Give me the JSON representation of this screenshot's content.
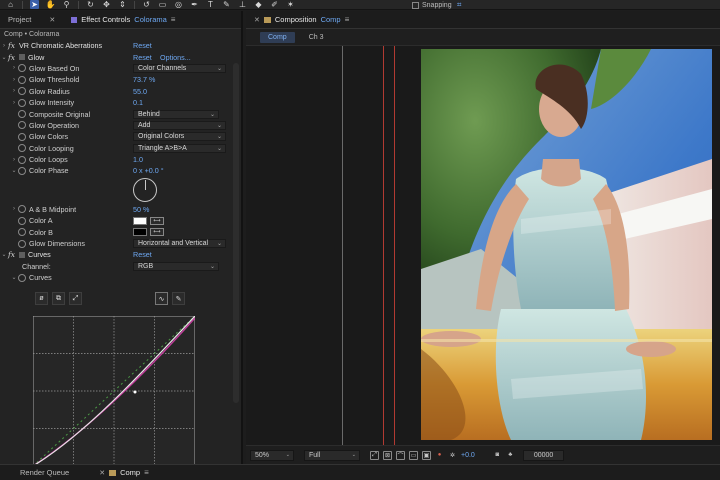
{
  "toolbar": {
    "icons": [
      "home-icon",
      "selection-tool-icon",
      "hand-tool-icon",
      "zoom-tool-icon",
      "orbit-tool-icon",
      "pan-tool-icon",
      "dolly-tool-icon",
      "rotate-tool-icon",
      "camera-tool-icon",
      "pan-behind-tool-icon",
      "pen-tool-icon",
      "type-tool-icon",
      "brush-tool-icon",
      "stamp-tool-icon",
      "eraser-tool-icon",
      "roto-brush-tool-icon",
      "puppet-tool-icon"
    ],
    "snapping_label": "Snapping"
  },
  "left_panel": {
    "tabs": {
      "project": "Project",
      "effect_controls_prefix": "Effect Controls",
      "effect_controls_layer": "Colorama"
    },
    "breadcrumb": "Comp • Colorama",
    "effects": {
      "vr_chromatic": {
        "name": "VR Chromatic Aberrations",
        "reset": "Reset"
      },
      "glow": {
        "name": "Glow",
        "reset": "Reset",
        "options": "Options...",
        "properties": [
          {
            "name": "Glow Based On",
            "type": "dropdown",
            "value": "Color Channels"
          },
          {
            "name": "Glow Threshold",
            "type": "value",
            "value": "73.7 %"
          },
          {
            "name": "Glow Radius",
            "type": "value",
            "value": "55.0"
          },
          {
            "name": "Glow Intensity",
            "type": "value",
            "value": "0.1"
          },
          {
            "name": "Composite Original",
            "type": "dropdown",
            "value": "Behind"
          },
          {
            "name": "Glow Operation",
            "type": "dropdown",
            "value": "Add"
          },
          {
            "name": "Glow Colors",
            "type": "dropdown",
            "value": "Original Colors"
          },
          {
            "name": "Color Looping",
            "type": "dropdown",
            "value": "Triangle A>B>A"
          },
          {
            "name": "Color Loops",
            "type": "value",
            "value": "1.0"
          },
          {
            "name": "Color Phase",
            "type": "value",
            "value": "0 x +0.0 °"
          },
          {
            "name": "A & B Midpoint",
            "type": "value",
            "value": "50 %"
          },
          {
            "name": "Color A",
            "type": "color",
            "value": "#ffffff"
          },
          {
            "name": "Color B",
            "type": "color",
            "value": "#000000"
          },
          {
            "name": "Glow Dimensions",
            "type": "dropdown",
            "value": "Horizontal and Vertical"
          }
        ]
      },
      "curves": {
        "name": "Curves",
        "reset": "Reset",
        "channel_label": "Channel:",
        "channel_value": "RGB",
        "sub_label": "Curves"
      }
    }
  },
  "comp_panel": {
    "tab_prefix": "Composition",
    "tab_name": "Comp",
    "sub_tabs": [
      "Comp",
      "Ch 3"
    ],
    "bottom": {
      "zoom": "50%",
      "resolution": "Full",
      "exposure": "+0.0",
      "timecode": "00000"
    }
  },
  "bottom_panel": {
    "render_queue": "Render Queue",
    "comp_tab": "Comp"
  },
  "colors": {
    "accent_blue": "#6ea8f2",
    "panel_bg": "#232323",
    "guide_red": "#c0392b"
  }
}
